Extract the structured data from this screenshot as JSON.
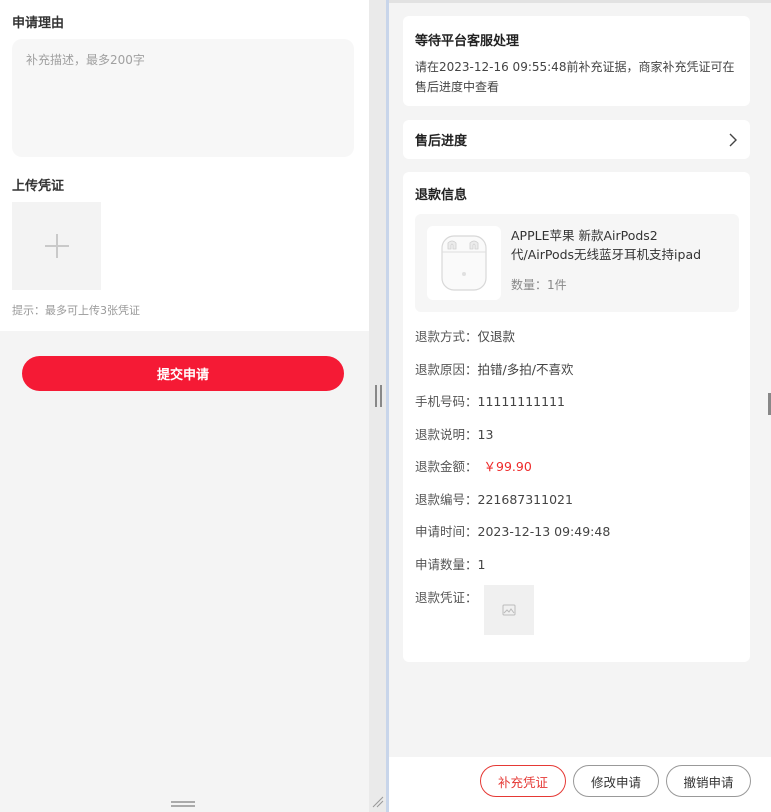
{
  "left": {
    "reason_title": "申请理由",
    "reason_placeholder": "补充描述，最多200字",
    "upload_title": "上传凭证",
    "upload_hint": "提示：最多可上传3张凭证",
    "submit_label": "提交申请",
    "icons": {
      "upload": "plus-icon"
    }
  },
  "right": {
    "status": {
      "title": "等待平台客服处理",
      "desc": "请在2023-12-16 09:55:48前补充证据，商家补充凭证可在售后进度中查看"
    },
    "progress": {
      "label": "售后进度",
      "icon": "chevron-right-icon"
    },
    "refund_info": {
      "title": "退款信息",
      "product": {
        "name_line1": "APPLE苹果 新款AirPods2",
        "name_line2": "代/AirPods无线蓝牙耳机支持ipad",
        "qty": "数量：1件",
        "image_icon": "airpods-image"
      },
      "rows": [
        {
          "label": "退款方式：",
          "value": "仅退款"
        },
        {
          "label": "退款原因：",
          "value": "拍错/多拍/不喜欢"
        },
        {
          "label": "手机号码：",
          "value": "11111111111"
        },
        {
          "label": "退款说明：",
          "value": "13"
        },
        {
          "label": "退款金额：",
          "value": "￥99.90"
        },
        {
          "label": "退款编号：",
          "value": "221687311021"
        },
        {
          "label": "申请时间：",
          "value": "2023-12-13 09:49:48"
        },
        {
          "label": "申请数量：",
          "value": "1"
        },
        {
          "label": "退款凭证：",
          "value": ""
        }
      ]
    },
    "actions": {
      "supplement": "补充凭证",
      "modify": "修改申请",
      "cancel": "撤销申请"
    }
  },
  "colors": {
    "accent": "#f51a35",
    "price": "#ee2a2a",
    "background": "#f4f4f4"
  }
}
